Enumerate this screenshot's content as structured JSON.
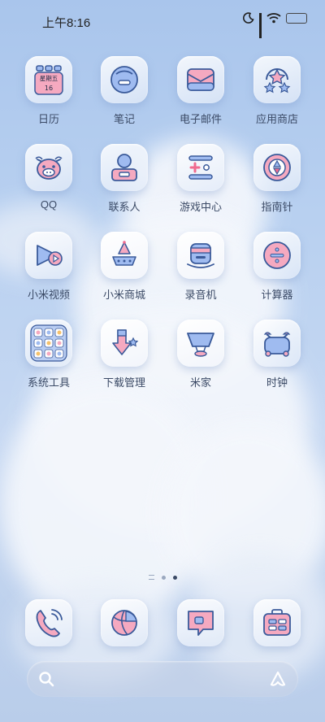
{
  "status_bar": {
    "time": "上午8:16",
    "icons": [
      "moon-icon",
      "signal-icon",
      "wifi-icon",
      "battery-icon"
    ]
  },
  "apps": [
    {
      "label": "日历",
      "icon": "calendar-icon",
      "weekday": "星期五",
      "day": "16"
    },
    {
      "label": "笔记",
      "icon": "notes-icon"
    },
    {
      "label": "电子邮件",
      "icon": "email-icon"
    },
    {
      "label": "应用商店",
      "icon": "app-store-icon"
    },
    {
      "label": "QQ",
      "icon": "qq-icon"
    },
    {
      "label": "联系人",
      "icon": "contacts-icon"
    },
    {
      "label": "游戏中心",
      "icon": "game-center-icon"
    },
    {
      "label": "指南针",
      "icon": "compass-icon"
    },
    {
      "label": "小米视频",
      "icon": "video-icon"
    },
    {
      "label": "小米商城",
      "icon": "mi-store-icon"
    },
    {
      "label": "录音机",
      "icon": "recorder-icon"
    },
    {
      "label": "计算器",
      "icon": "calculator-icon"
    },
    {
      "label": "系统工具",
      "icon": "system-tools-folder-icon"
    },
    {
      "label": "下载管理",
      "icon": "download-manager-icon"
    },
    {
      "label": "米家",
      "icon": "mijia-icon"
    },
    {
      "label": "时钟",
      "icon": "clock-icon"
    }
  ],
  "page_indicator": {
    "pages": 2,
    "current": 2
  },
  "dock": [
    {
      "icon": "phone-icon"
    },
    {
      "icon": "browser-icon"
    },
    {
      "icon": "messages-icon"
    },
    {
      "icon": "toolbox-icon"
    }
  ],
  "search_bar": {
    "left_icon": "search-icon",
    "right_icon": "assistant-icon"
  },
  "colors": {
    "icon_stroke": "#3a5a9a",
    "icon_blue": "#9fbbf0",
    "icon_pink": "#f5a9c0",
    "label_text": "#3b4a66"
  }
}
